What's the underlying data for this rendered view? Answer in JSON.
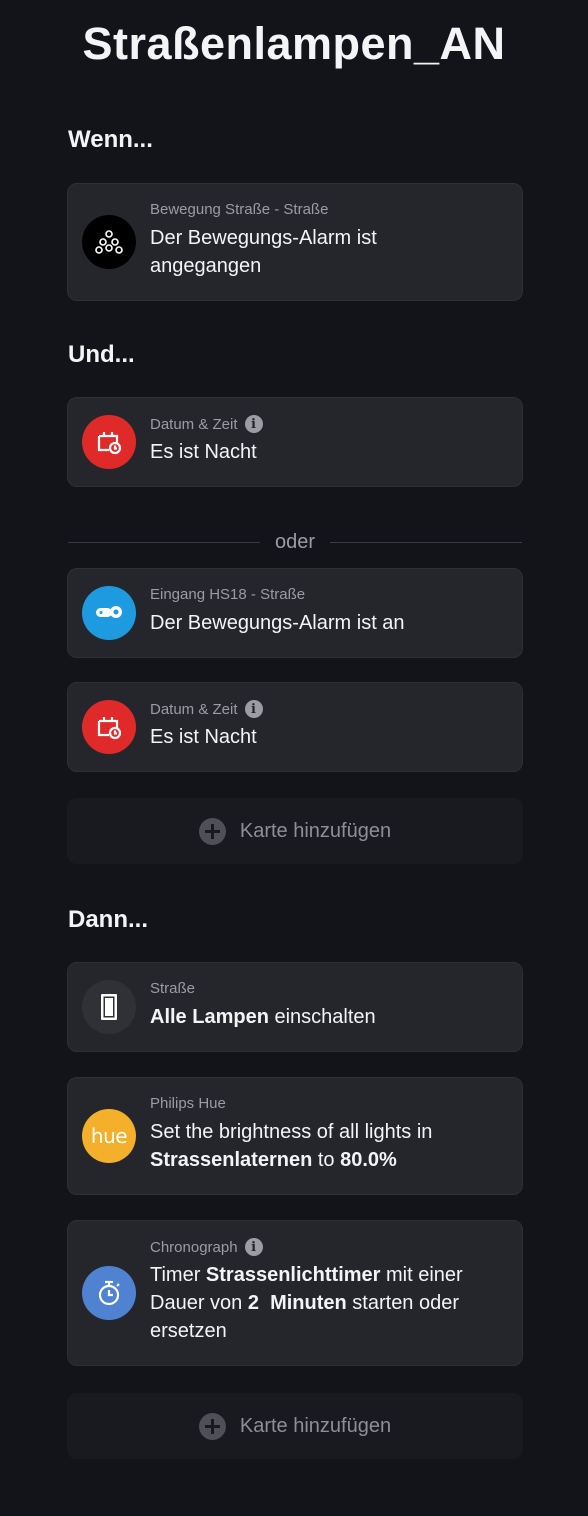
{
  "page_title": "Straßenlampen_AN",
  "sections": {
    "when": "Wenn...",
    "and": "Und...",
    "then": "Dann..."
  },
  "divider": "oder",
  "cards": {
    "when_1": {
      "owner": "Bewegung Straße - Straße",
      "line1": "Der Bewegungs-Alarm ist",
      "line2": "angegangen"
    },
    "and_1": {
      "owner": "Datum & Zeit",
      "text": "Es ist Nacht"
    },
    "and_2": {
      "owner": "Eingang HS18 - Straße",
      "text": "Der Bewegungs-Alarm ist an"
    },
    "and_3": {
      "owner": "Datum & Zeit",
      "text": "Es ist Nacht"
    },
    "then_1": {
      "owner": "Straße",
      "bold": "Alle Lampen",
      "rest": " einschalten"
    },
    "then_2": {
      "owner": "Philips Hue",
      "line1": "Set the brightness of all lights in",
      "bold1": "Strassenlaternen",
      "mid": " to ",
      "bold2": "80.0%",
      "icon_text": "hue"
    },
    "then_3": {
      "owner": "Chronograph",
      "pre": "Timer ",
      "bold1": "Strassenlichttimer",
      "post1": " mit einer",
      "pre2": "Dauer von ",
      "bold2": "2  Minuten",
      "post2": " starten oder",
      "line3": "ersetzen"
    }
  },
  "add_card_label": "Karte hinzufügen",
  "icons": {
    "motion": "motion-sensor-icon",
    "calendar": "calendar-clock-icon",
    "camera": "camera-icon",
    "door": "door-icon",
    "hue": "hue-logo-icon",
    "timer": "stopwatch-icon",
    "info": "info-icon",
    "plus": "plus-icon"
  },
  "colors": {
    "background": "#131419",
    "card": "#25262b",
    "calendar_red": "#e02a2a",
    "camera_blue": "#1e9be0",
    "hue_yellow": "#f4b02a",
    "timer_blue": "#4f83d1"
  }
}
